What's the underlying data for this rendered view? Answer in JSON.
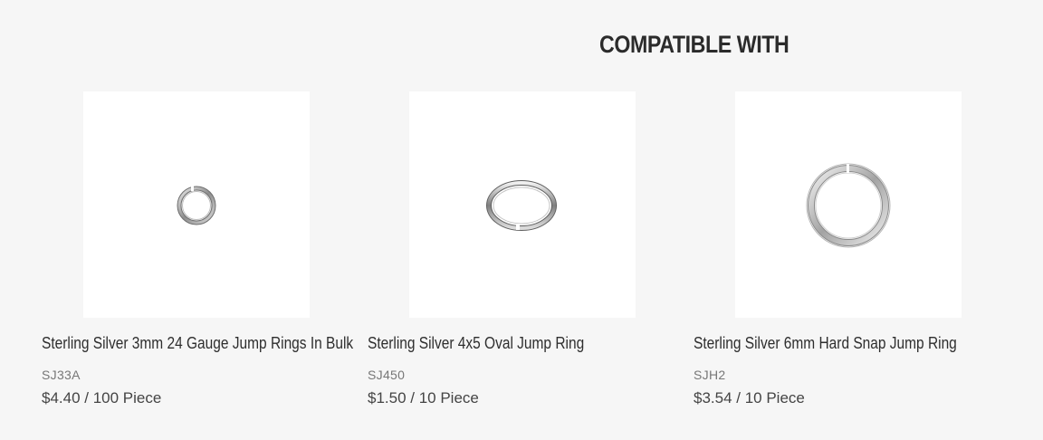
{
  "section": {
    "title": "COMPATIBLE WITH"
  },
  "products": [
    {
      "name": "Sterling Silver 3mm 24 Gauge Jump Rings In Bulk",
      "sku": "SJ33A",
      "price": "$4.40 / 100 Piece",
      "image_icon": "round-jump-ring-small-icon"
    },
    {
      "name": "Sterling Silver 4x5 Oval Jump Ring",
      "sku": "SJ450",
      "price": "$1.50 / 10 Piece",
      "image_icon": "oval-jump-ring-icon"
    },
    {
      "name": "Sterling Silver 6mm Hard Snap Jump Ring",
      "sku": "SJH2",
      "price": "$3.54 / 10 Piece",
      "image_icon": "round-jump-ring-large-icon"
    }
  ],
  "colors": {
    "background": "#f6f6f6",
    "card_image_bg": "#ffffff",
    "title": "#2b2b2b",
    "sku": "#777777",
    "price": "#444444"
  }
}
